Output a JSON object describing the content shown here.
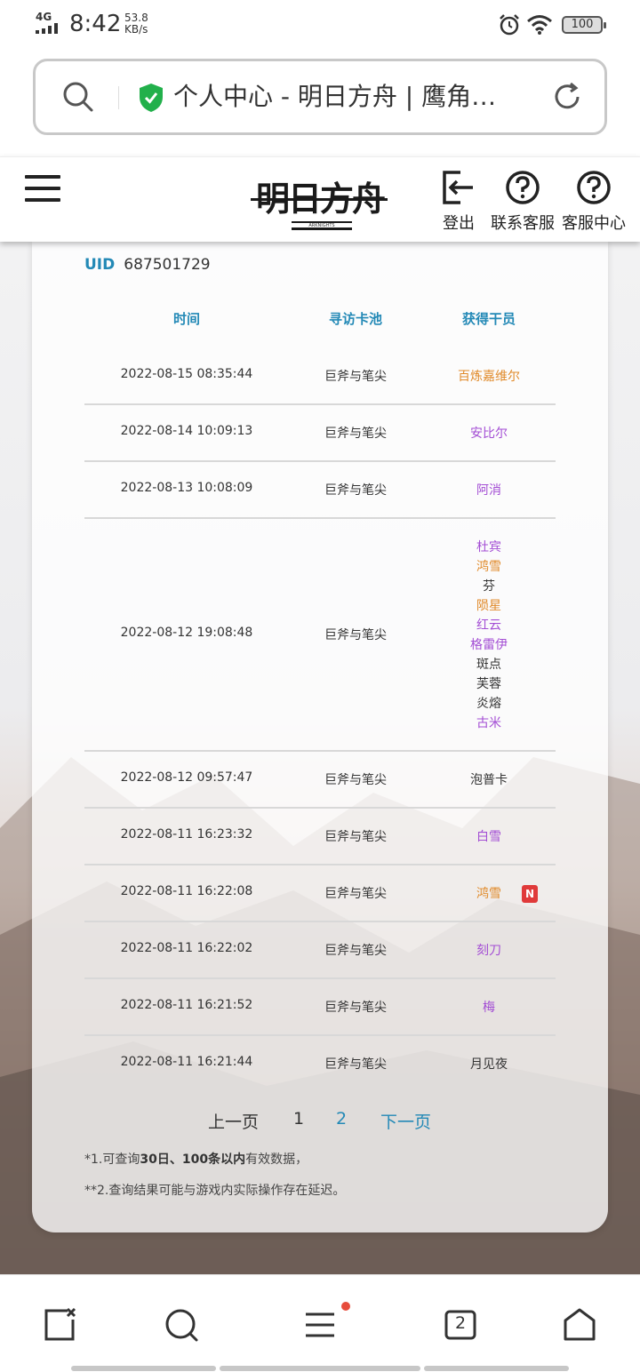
{
  "status_bar": {
    "network": "4G",
    "time": "8:42",
    "speed_value": "53.8",
    "speed_unit": "KB/s",
    "battery": "100"
  },
  "url_bar": {
    "title": "个人中心 - 明日方舟 | 鹰角…"
  },
  "header": {
    "logo_text": "明日方舟",
    "logo_sub": "ARKNIGHTS",
    "logout_label": "登出",
    "contact_label": "联系客服",
    "service_center_label": "客服中心"
  },
  "card": {
    "uid_label": "UID",
    "uid_value": "687501729",
    "columns": [
      "时间",
      "寻访卡池",
      "获得干员"
    ],
    "rows": [
      {
        "time": "2022-08-15 08:35:44",
        "pool": "巨斧与笔尖",
        "operators": [
          {
            "name": "百炼嘉维尔",
            "tier": "gold"
          }
        ]
      },
      {
        "time": "2022-08-14 10:09:13",
        "pool": "巨斧与笔尖",
        "operators": [
          {
            "name": "安比尔",
            "tier": "purple"
          }
        ]
      },
      {
        "time": "2022-08-13 10:08:09",
        "pool": "巨斧与笔尖",
        "operators": [
          {
            "name": "阿消",
            "tier": "purple"
          }
        ]
      },
      {
        "time": "2022-08-12 19:08:48",
        "pool": "巨斧与笔尖",
        "operators": [
          {
            "name": "杜宾",
            "tier": "purple"
          },
          {
            "name": "鸿雪",
            "tier": "gold"
          },
          {
            "name": "芬",
            "tier": "normal"
          },
          {
            "name": "陨星",
            "tier": "gold"
          },
          {
            "name": "红云",
            "tier": "purple"
          },
          {
            "name": "格雷伊",
            "tier": "purple"
          },
          {
            "name": "斑点",
            "tier": "normal"
          },
          {
            "name": "芙蓉",
            "tier": "normal"
          },
          {
            "name": "炎熔",
            "tier": "normal"
          },
          {
            "name": "古米",
            "tier": "purple"
          }
        ]
      },
      {
        "time": "2022-08-12 09:57:47",
        "pool": "巨斧与笔尖",
        "operators": [
          {
            "name": "泡普卡",
            "tier": "normal"
          }
        ]
      },
      {
        "time": "2022-08-11 16:23:32",
        "pool": "巨斧与笔尖",
        "operators": [
          {
            "name": "白雪",
            "tier": "purple"
          }
        ]
      },
      {
        "time": "2022-08-11 16:22:08",
        "pool": "巨斧与笔尖",
        "operators": [
          {
            "name": "鸿雪",
            "tier": "gold"
          }
        ],
        "badge": "N"
      },
      {
        "time": "2022-08-11 16:22:02",
        "pool": "巨斧与笔尖",
        "operators": [
          {
            "name": "刻刀",
            "tier": "purple"
          }
        ]
      },
      {
        "time": "2022-08-11 16:21:52",
        "pool": "巨斧与笔尖",
        "operators": [
          {
            "name": "梅",
            "tier": "purple"
          }
        ]
      },
      {
        "time": "2022-08-11 16:21:44",
        "pool": "巨斧与笔尖",
        "operators": [
          {
            "name": "月见夜",
            "tier": "normal"
          }
        ]
      }
    ],
    "pager": {
      "prev": "上一页",
      "page1": "1",
      "page2": "2",
      "next": "下一页"
    },
    "note1_a": "*1.可查询",
    "note1_b": "30日、100条以内",
    "note1_c": "有效数据，",
    "note2": "**2.查询结果可能与游戏内实际操作存在延迟。"
  },
  "bottom_nav": {
    "tab_count": "2"
  },
  "colors": {
    "accent": "#2389b6",
    "gold": "#e08a2a",
    "purple": "#a34dd4",
    "badge": "#e03a3a"
  }
}
